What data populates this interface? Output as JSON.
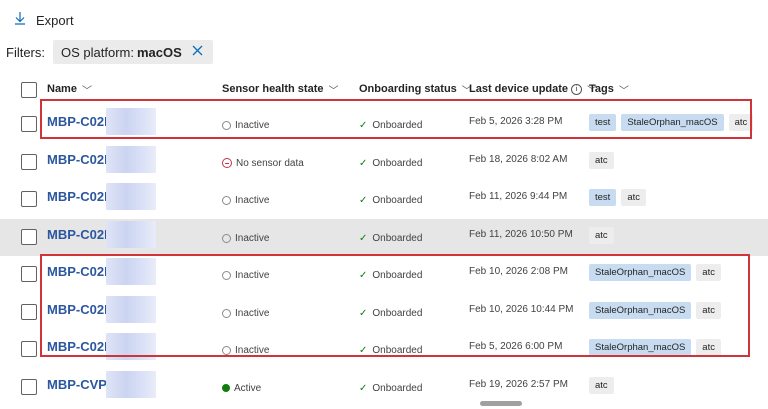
{
  "toolbar": {
    "export_label": "Export",
    "export_icon": "download-arrow-icon"
  },
  "filters": {
    "label": "Filters:",
    "chip_label": "OS platform: ",
    "chip_value": "macOS",
    "chip_close_icon": "close-icon"
  },
  "columns": {
    "name": "Name",
    "sensor_health": "Sensor health state",
    "onboarding": "Onboarding status",
    "last_update": "Last device update",
    "tags": "Tags"
  },
  "rows": [
    {
      "name": "MBP-C02D",
      "health": "Inactive",
      "onboarding": "Onboarded",
      "updated": "Feb 5, 2026 3:28 PM",
      "tags": [
        {
          "text": "test",
          "style": "blue"
        },
        {
          "text": "StaleOrphan_macOS",
          "style": "blue"
        },
        {
          "text": "atc",
          "style": "gray"
        }
      ]
    },
    {
      "name": "MBP-C02D",
      "health": "No sensor data",
      "onboarding": "Onboarded",
      "updated": "Feb 18, 2026 8:02 AM",
      "tags": [
        {
          "text": "atc",
          "style": "gray"
        }
      ]
    },
    {
      "name": "MBP-C02D",
      "health": "Inactive",
      "onboarding": "Onboarded",
      "updated": "Feb 11, 2026 9:44 PM",
      "tags": [
        {
          "text": "test",
          "style": "blue"
        },
        {
          "text": "atc",
          "style": "gray"
        }
      ]
    },
    {
      "name": "MBP-C02D",
      "health": "Inactive",
      "onboarding": "Onboarded",
      "updated": "Feb 11, 2026 10:50 PM",
      "tags": [
        {
          "text": "atc",
          "style": "gray"
        }
      ],
      "selected": true
    },
    {
      "name": "MBP-C02D",
      "health": "Inactive",
      "onboarding": "Onboarded",
      "updated": "Feb 10, 2026 2:08 PM",
      "tags": [
        {
          "text": "StaleOrphan_macOS",
          "style": "blue"
        },
        {
          "text": "atc",
          "style": "gray"
        }
      ]
    },
    {
      "name": "MBP-C02D",
      "health": "Inactive",
      "onboarding": "Onboarded",
      "updated": "Feb 10, 2026 10:44 PM",
      "tags": [
        {
          "text": "StaleOrphan_macOS",
          "style": "blue"
        },
        {
          "text": "atc",
          "style": "gray"
        }
      ]
    },
    {
      "name": "MBP-C02D",
      "health": "Inactive",
      "onboarding": "Onboarded",
      "updated": "Feb 5, 2026 6:00 PM",
      "tags": [
        {
          "text": "StaleOrphan_macOS",
          "style": "blue"
        },
        {
          "text": "atc",
          "style": "gray"
        }
      ]
    },
    {
      "name": "MBP-CVPX",
      "health": "Active",
      "onboarding": "Onboarded",
      "updated": "Feb 19, 2026 2:57 PM",
      "tags": [
        {
          "text": "atc",
          "style": "gray"
        }
      ]
    }
  ],
  "colors": {
    "link": "#2b57a0",
    "highlight_border": "#d13438",
    "tag_blue": "#c7dcf0",
    "active": "#107c10"
  }
}
